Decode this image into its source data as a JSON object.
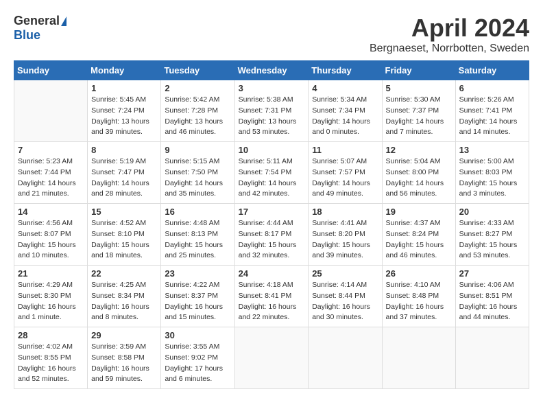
{
  "header": {
    "logo_general": "General",
    "logo_blue": "Blue",
    "month_title": "April 2024",
    "location": "Bergnaeset, Norrbotten, Sweden"
  },
  "weekdays": [
    "Sunday",
    "Monday",
    "Tuesday",
    "Wednesday",
    "Thursday",
    "Friday",
    "Saturday"
  ],
  "weeks": [
    [
      {
        "day": "",
        "info": ""
      },
      {
        "day": "1",
        "info": "Sunrise: 5:45 AM\nSunset: 7:24 PM\nDaylight: 13 hours\nand 39 minutes."
      },
      {
        "day": "2",
        "info": "Sunrise: 5:42 AM\nSunset: 7:28 PM\nDaylight: 13 hours\nand 46 minutes."
      },
      {
        "day": "3",
        "info": "Sunrise: 5:38 AM\nSunset: 7:31 PM\nDaylight: 13 hours\nand 53 minutes."
      },
      {
        "day": "4",
        "info": "Sunrise: 5:34 AM\nSunset: 7:34 PM\nDaylight: 14 hours\nand 0 minutes."
      },
      {
        "day": "5",
        "info": "Sunrise: 5:30 AM\nSunset: 7:37 PM\nDaylight: 14 hours\nand 7 minutes."
      },
      {
        "day": "6",
        "info": "Sunrise: 5:26 AM\nSunset: 7:41 PM\nDaylight: 14 hours\nand 14 minutes."
      }
    ],
    [
      {
        "day": "7",
        "info": "Sunrise: 5:23 AM\nSunset: 7:44 PM\nDaylight: 14 hours\nand 21 minutes."
      },
      {
        "day": "8",
        "info": "Sunrise: 5:19 AM\nSunset: 7:47 PM\nDaylight: 14 hours\nand 28 minutes."
      },
      {
        "day": "9",
        "info": "Sunrise: 5:15 AM\nSunset: 7:50 PM\nDaylight: 14 hours\nand 35 minutes."
      },
      {
        "day": "10",
        "info": "Sunrise: 5:11 AM\nSunset: 7:54 PM\nDaylight: 14 hours\nand 42 minutes."
      },
      {
        "day": "11",
        "info": "Sunrise: 5:07 AM\nSunset: 7:57 PM\nDaylight: 14 hours\nand 49 minutes."
      },
      {
        "day": "12",
        "info": "Sunrise: 5:04 AM\nSunset: 8:00 PM\nDaylight: 14 hours\nand 56 minutes."
      },
      {
        "day": "13",
        "info": "Sunrise: 5:00 AM\nSunset: 8:03 PM\nDaylight: 15 hours\nand 3 minutes."
      }
    ],
    [
      {
        "day": "14",
        "info": "Sunrise: 4:56 AM\nSunset: 8:07 PM\nDaylight: 15 hours\nand 10 minutes."
      },
      {
        "day": "15",
        "info": "Sunrise: 4:52 AM\nSunset: 8:10 PM\nDaylight: 15 hours\nand 18 minutes."
      },
      {
        "day": "16",
        "info": "Sunrise: 4:48 AM\nSunset: 8:13 PM\nDaylight: 15 hours\nand 25 minutes."
      },
      {
        "day": "17",
        "info": "Sunrise: 4:44 AM\nSunset: 8:17 PM\nDaylight: 15 hours\nand 32 minutes."
      },
      {
        "day": "18",
        "info": "Sunrise: 4:41 AM\nSunset: 8:20 PM\nDaylight: 15 hours\nand 39 minutes."
      },
      {
        "day": "19",
        "info": "Sunrise: 4:37 AM\nSunset: 8:24 PM\nDaylight: 15 hours\nand 46 minutes."
      },
      {
        "day": "20",
        "info": "Sunrise: 4:33 AM\nSunset: 8:27 PM\nDaylight: 15 hours\nand 53 minutes."
      }
    ],
    [
      {
        "day": "21",
        "info": "Sunrise: 4:29 AM\nSunset: 8:30 PM\nDaylight: 16 hours\nand 1 minute."
      },
      {
        "day": "22",
        "info": "Sunrise: 4:25 AM\nSunset: 8:34 PM\nDaylight: 16 hours\nand 8 minutes."
      },
      {
        "day": "23",
        "info": "Sunrise: 4:22 AM\nSunset: 8:37 PM\nDaylight: 16 hours\nand 15 minutes."
      },
      {
        "day": "24",
        "info": "Sunrise: 4:18 AM\nSunset: 8:41 PM\nDaylight: 16 hours\nand 22 minutes."
      },
      {
        "day": "25",
        "info": "Sunrise: 4:14 AM\nSunset: 8:44 PM\nDaylight: 16 hours\nand 30 minutes."
      },
      {
        "day": "26",
        "info": "Sunrise: 4:10 AM\nSunset: 8:48 PM\nDaylight: 16 hours\nand 37 minutes."
      },
      {
        "day": "27",
        "info": "Sunrise: 4:06 AM\nSunset: 8:51 PM\nDaylight: 16 hours\nand 44 minutes."
      }
    ],
    [
      {
        "day": "28",
        "info": "Sunrise: 4:02 AM\nSunset: 8:55 PM\nDaylight: 16 hours\nand 52 minutes."
      },
      {
        "day": "29",
        "info": "Sunrise: 3:59 AM\nSunset: 8:58 PM\nDaylight: 16 hours\nand 59 minutes."
      },
      {
        "day": "30",
        "info": "Sunrise: 3:55 AM\nSunset: 9:02 PM\nDaylight: 17 hours\nand 6 minutes."
      },
      {
        "day": "",
        "info": ""
      },
      {
        "day": "",
        "info": ""
      },
      {
        "day": "",
        "info": ""
      },
      {
        "day": "",
        "info": ""
      }
    ]
  ]
}
